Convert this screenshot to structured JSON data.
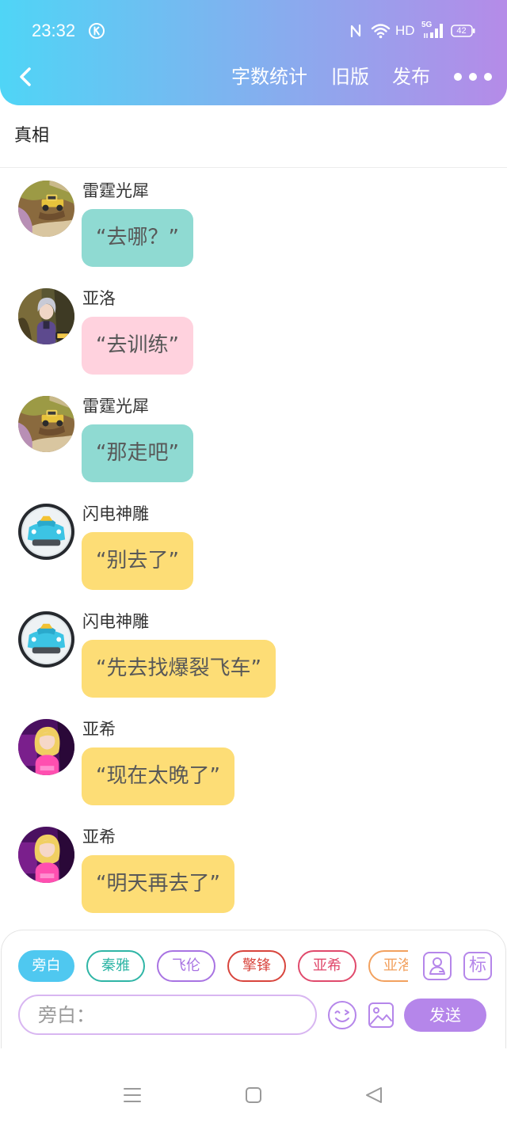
{
  "status_bar": {
    "time": "23:32",
    "hd_label": "HD",
    "network_type": "5G",
    "battery": "42",
    "icons": [
      "k-circle-icon",
      "nfc-icon",
      "wifi-icon",
      "signal-icon",
      "battery-icon"
    ]
  },
  "header": {
    "back_icon": "chevron-left-icon",
    "actions": [
      "字数统计",
      "旧版",
      "发布"
    ],
    "more_icon": "more-dots-icon",
    "gradient": [
      "#4fd5f6",
      "#b58be8"
    ]
  },
  "title": "真相",
  "messages": [
    {
      "name": "雷霆光犀",
      "text": "“去哪？”",
      "bubble_color": "#8fdad2",
      "avatar": "rhino-car-avatar"
    },
    {
      "name": "亚洛",
      "text": "“去训练”",
      "bubble_color": "#ffd2de",
      "avatar": "yaluo-avatar"
    },
    {
      "name": "雷霆光犀",
      "text": "“那走吧”",
      "bubble_color": "#8fdad2",
      "avatar": "rhino-car-avatar"
    },
    {
      "name": "闪电神雕",
      "text": "“别去了”",
      "bubble_color": "#fddd76",
      "avatar": "lightning-car-avatar"
    },
    {
      "name": "闪电神雕",
      "text": "“先去找爆裂飞车”",
      "bubble_color": "#fddd76",
      "avatar": "lightning-car-avatar"
    },
    {
      "name": "亚希",
      "text": "“现在太晚了”",
      "bubble_color": "#fddd76",
      "avatar": "yaxi-avatar"
    },
    {
      "name": "亚希",
      "text": "“明天再去了”",
      "bubble_color": "#fddd76",
      "avatar": "yaxi-avatar"
    }
  ],
  "composer": {
    "roles": [
      {
        "label": "旁白",
        "color": "#4fc8f0",
        "selected": true
      },
      {
        "label": "秦雅",
        "color": "#2fb5a6",
        "selected": false
      },
      {
        "label": "飞伦",
        "color": "#a873e2",
        "selected": false
      },
      {
        "label": "擎锋",
        "color": "#d8453d",
        "selected": false
      },
      {
        "label": "亚希",
        "color": "#e04a6c",
        "selected": false
      },
      {
        "label": "亚洛",
        "color": "#f2a15f",
        "selected": false
      }
    ],
    "role_icon": "person-icon",
    "tag_label": "标",
    "placeholder": "旁白：",
    "emoji_icon": "emoji-icon",
    "image_icon": "image-icon",
    "send_label": "发送",
    "accent": "#b586ea"
  },
  "nav_bar": {
    "icons": [
      "menu-icon",
      "home-square-icon",
      "back-triangle-icon"
    ]
  }
}
